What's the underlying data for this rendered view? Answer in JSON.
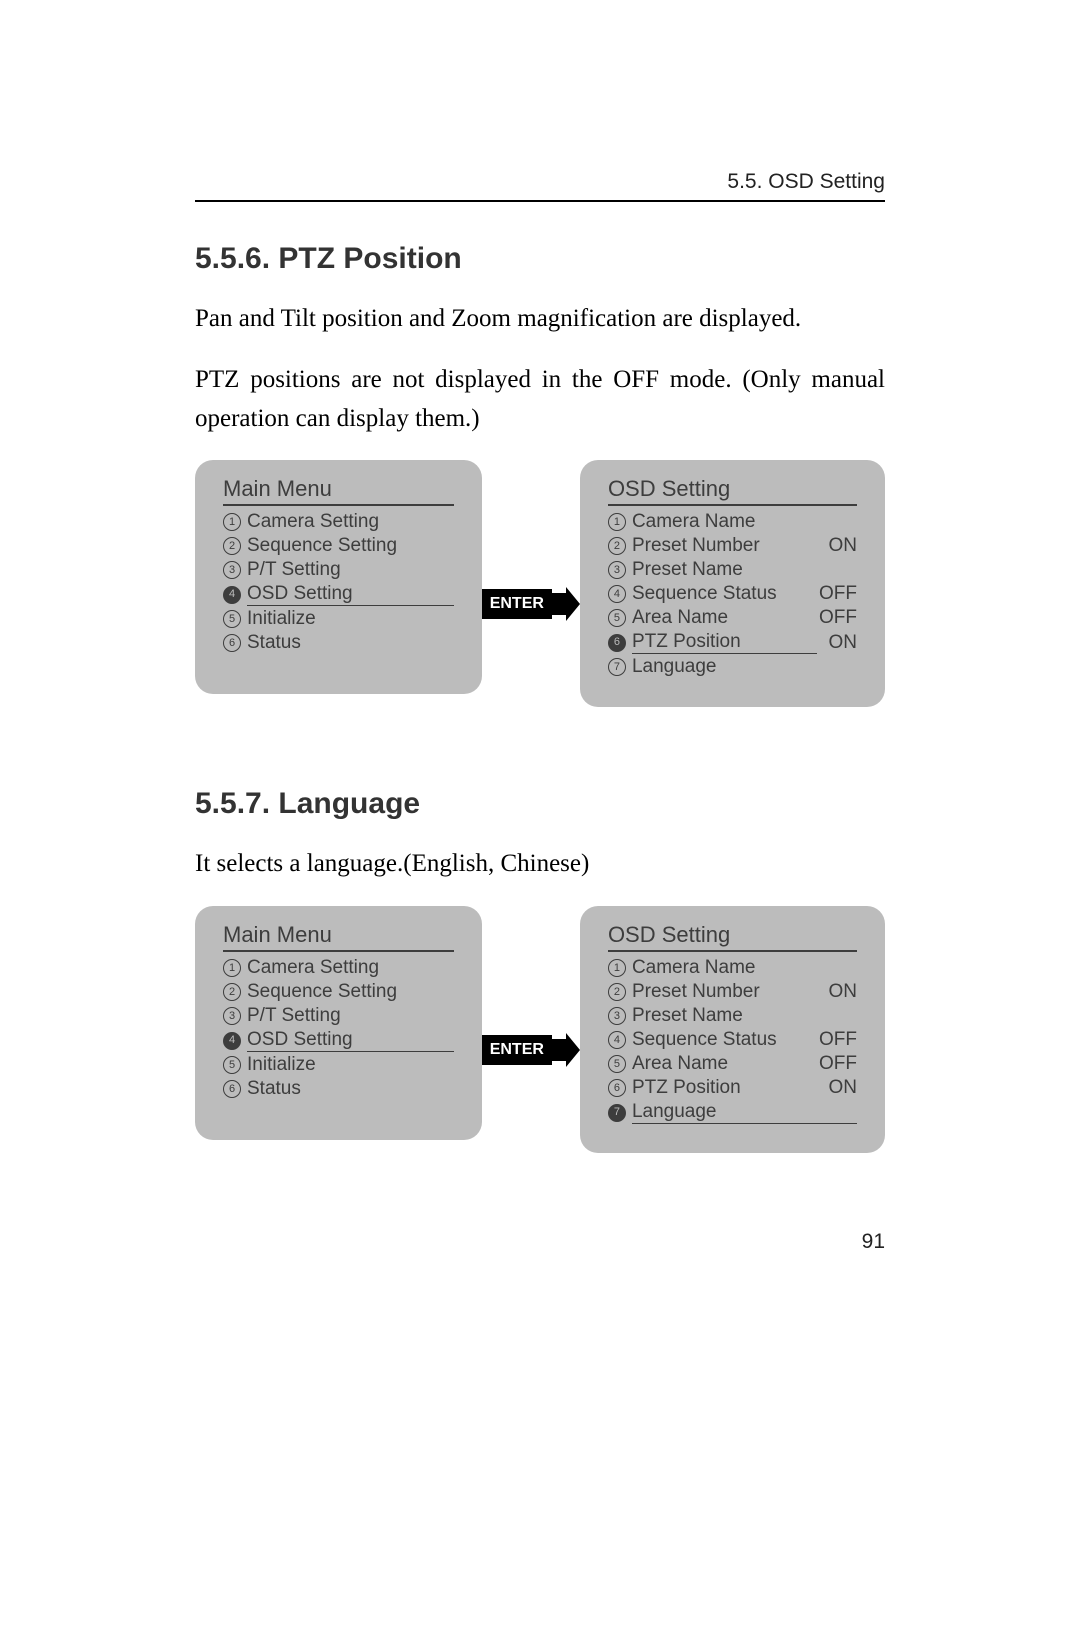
{
  "header": {
    "breadcrumb": "5.5. OSD Setting"
  },
  "sections": {
    "s1": {
      "heading": "5.5.6. PTZ Position",
      "para1": "Pan and Tilt position and Zoom magnification are displayed.",
      "para2": "PTZ positions are not displayed in the OFF mode. (Only manual operation can display them.)"
    },
    "s2": {
      "heading": "5.5.7. Language",
      "para1": "It selects a language.(English, Chinese)"
    }
  },
  "enter_label": "ENTER",
  "main_menu_title": "Main Menu",
  "osd_title": "OSD Setting",
  "main_menu": {
    "items": [
      {
        "n": "1",
        "label": "Camera Setting"
      },
      {
        "n": "2",
        "label": "Sequence Setting"
      },
      {
        "n": "3",
        "label": "P/T Setting"
      },
      {
        "n": "4",
        "label": "OSD Setting"
      },
      {
        "n": "5",
        "label": "Initialize"
      },
      {
        "n": "6",
        "label": "Status"
      }
    ],
    "active_index": 3
  },
  "osd_menu": {
    "items": [
      {
        "n": "1",
        "label": "Camera Name",
        "value": ""
      },
      {
        "n": "2",
        "label": "Preset Number",
        "value": "ON"
      },
      {
        "n": "3",
        "label": "Preset Name",
        "value": ""
      },
      {
        "n": "4",
        "label": "Sequence Status",
        "value": "OFF"
      },
      {
        "n": "5",
        "label": "Area Name",
        "value": "OFF"
      },
      {
        "n": "6",
        "label": "PTZ Position",
        "value": "ON"
      },
      {
        "n": "7",
        "label": "Language",
        "value": ""
      }
    ],
    "active_index_fig1": 5,
    "active_index_fig2": 6
  },
  "page_number": "91"
}
